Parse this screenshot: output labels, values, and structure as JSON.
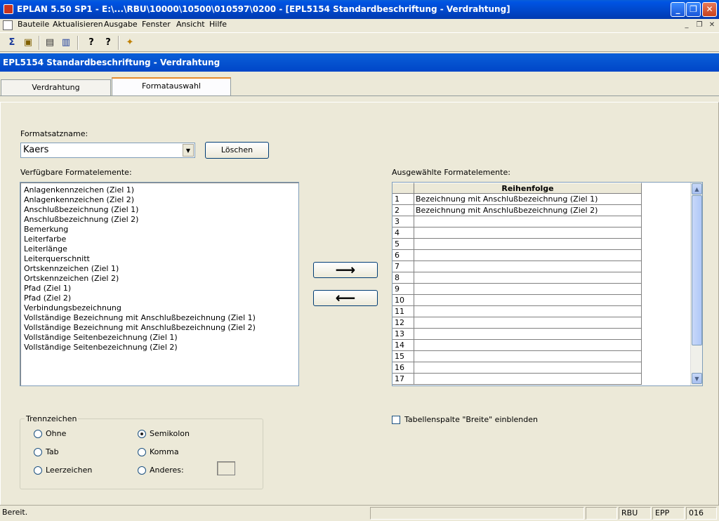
{
  "window": {
    "title": "EPLAN 5.50 SP1 - E:\\...\\RBU\\10000\\10500\\010597\\0200 - [EPL5154 Standardbeschriftung - Verdrahtung]",
    "minimize": "_",
    "restore": "❐",
    "close": "✕"
  },
  "menu": {
    "items": [
      "Bauteile",
      "Aktualisieren",
      "Ausgabe",
      "Fenster",
      "Ansicht",
      "Hilfe"
    ],
    "mdi_min": "_",
    "mdi_restore": "❐",
    "mdi_close": "✕"
  },
  "toolbar": {
    "icons": [
      "component-icon",
      "open-folder-icon",
      "list-icon",
      "export-icon",
      "help-icon",
      "context-help-icon",
      "wizard-icon"
    ],
    "glyphs": [
      "Σ",
      "▣",
      "▤",
      "▥",
      "?",
      "?",
      "✦"
    ]
  },
  "dialog": {
    "title": "EPL5154 Standardbeschriftung - Verdrahtung",
    "tabs": [
      {
        "label": "Verdrahtung",
        "active": false
      },
      {
        "label": "Formatauswahl",
        "active": true
      }
    ]
  },
  "form": {
    "formatsatzname_label": "Formatsatzname:",
    "formatsatzname_value": "Kaers",
    "loeschen_label": "Löschen",
    "verfuegbar_label": "Verfügbare Formatelemente:",
    "ausgewaehlt_label": "Ausgewählte Formatelemente:",
    "available_elements": [
      "Anlagenkennzeichen (Ziel 1)",
      "Anlagenkennzeichen (Ziel 2)",
      "Anschlußbezeichnung (Ziel 1)",
      "Anschlußbezeichnung (Ziel 2)",
      "Bemerkung",
      "Leiterfarbe",
      "Leiterlänge",
      "Leiterquerschnitt",
      "Ortskennzeichen (Ziel 1)",
      "Ortskennzeichen (Ziel 2)",
      "Pfad (Ziel 1)",
      "Pfad (Ziel 2)",
      "Verbindungsbezeichnung",
      "Vollständige Bezeichnung mit Anschlußbezeichnung (Ziel 1)",
      "Vollständige Bezeichnung mit Anschlußbezeichnung (Ziel 2)",
      "Vollständige Seitenbezeichnung (Ziel 1)",
      "Vollständige Seitenbezeichnung (Ziel 2)"
    ],
    "grid": {
      "column_header": "Reihenfolge",
      "rows": [
        {
          "num": "1",
          "value": "Bezeichnung mit Anschlußbezeichnung (Ziel 1)"
        },
        {
          "num": "2",
          "value": "Bezeichnung mit Anschlußbezeichnung (Ziel 2)"
        },
        {
          "num": "3",
          "value": ""
        },
        {
          "num": "4",
          "value": ""
        },
        {
          "num": "5",
          "value": ""
        },
        {
          "num": "6",
          "value": ""
        },
        {
          "num": "7",
          "value": ""
        },
        {
          "num": "8",
          "value": ""
        },
        {
          "num": "9",
          "value": ""
        },
        {
          "num": "10",
          "value": ""
        },
        {
          "num": "11",
          "value": ""
        },
        {
          "num": "12",
          "value": ""
        },
        {
          "num": "13",
          "value": ""
        },
        {
          "num": "14",
          "value": ""
        },
        {
          "num": "15",
          "value": ""
        },
        {
          "num": "16",
          "value": ""
        },
        {
          "num": "17",
          "value": ""
        }
      ]
    },
    "add_arrow": "⟶",
    "remove_arrow": "⟵",
    "trennzeichen": {
      "legend": "Trennzeichen",
      "options": [
        {
          "label": "Ohne",
          "checked": false
        },
        {
          "label": "Semikolon",
          "checked": true
        },
        {
          "label": "Tab",
          "checked": false
        },
        {
          "label": "Komma",
          "checked": false
        },
        {
          "label": "Leerzeichen",
          "checked": false
        },
        {
          "label": "Anderes:",
          "checked": false
        }
      ]
    },
    "breite_checkbox": {
      "label": "Tabellenspalte \"Breite\" einblenden",
      "checked": false
    }
  },
  "statusbar": {
    "message": "Bereit.",
    "panes": [
      "",
      "",
      "RBU",
      "EPP",
      "016"
    ]
  }
}
